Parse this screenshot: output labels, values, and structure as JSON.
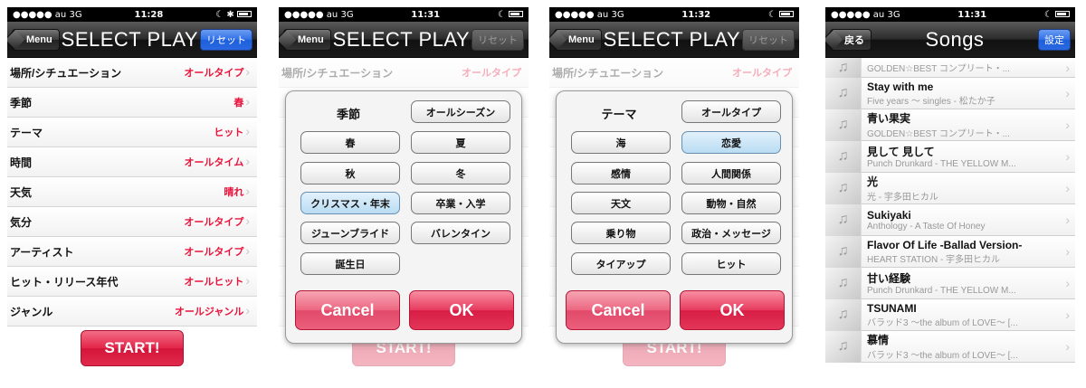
{
  "screens": [
    {
      "status": {
        "carrier": "●●●●● au  3G",
        "time": "11:28",
        "right": "☾ ✱"
      },
      "nav": {
        "back": "Menu",
        "title": "SELECT PLAY",
        "reset": "リセット"
      },
      "rows": [
        {
          "label": "場所/シチュエーション",
          "value": "オールタイプ"
        },
        {
          "label": "季節",
          "value": "春"
        },
        {
          "label": "テーマ",
          "value": "ヒット"
        },
        {
          "label": "時間",
          "value": "オールタイム"
        },
        {
          "label": "天気",
          "value": "晴れ"
        },
        {
          "label": "気分",
          "value": "オールタイプ"
        },
        {
          "label": "アーティスト",
          "value": "オールタイプ"
        },
        {
          "label": "ヒット・リリース年代",
          "value": "オールヒット"
        },
        {
          "label": "ジャンル",
          "value": "オールジャンル"
        }
      ],
      "start": "START!"
    },
    {
      "status": {
        "carrier": "●●●●● au  3G",
        "time": "11:31",
        "right": "☾"
      },
      "nav": {
        "back": "Menu",
        "title": "SELECT PLAY",
        "reset": "リセット"
      },
      "row_label": "場所/シチュエーション",
      "row_value": "オールタイプ",
      "dialog": {
        "heading": "季節",
        "options": [
          "オールシーズン",
          "春",
          "夏",
          "秋",
          "冬",
          "クリスマス・年末",
          "卒業・入学",
          "ジューンブライド",
          "バレンタイン",
          "誕生日"
        ],
        "selected": "クリスマス・年末",
        "cancel": "Cancel",
        "ok": "OK"
      },
      "start": "START!"
    },
    {
      "status": {
        "carrier": "●●●●● au  3G",
        "time": "11:32",
        "right": "☾"
      },
      "nav": {
        "back": "Menu",
        "title": "SELECT PLAY",
        "reset": "リセット"
      },
      "row_label": "場所/シチュエーション",
      "row_value": "オールタイプ",
      "dialog": {
        "heading": "テーマ",
        "options": [
          "オールタイプ",
          "海",
          "恋愛",
          "感情",
          "人間関係",
          "天文",
          "動物・自然",
          "乗り物",
          "政治・メッセージ",
          "タイアップ",
          "ヒット"
        ],
        "selected": "恋愛",
        "cancel": "Cancel",
        "ok": "OK"
      },
      "start": "START!"
    },
    {
      "status": {
        "carrier": "●●●●● au  3G",
        "time": "11:31",
        "right": "☾"
      },
      "nav": {
        "back": "戻る",
        "title": "Songs",
        "reset": "設定"
      },
      "partial_sub": "GOLDEN☆BEST コンプリート・...",
      "songs": [
        {
          "title": "Stay with me",
          "sub": "Five years 〜 singles - 松たか子"
        },
        {
          "title": "青い果実",
          "sub": "GOLDEN☆BEST コンプリート・..."
        },
        {
          "title": "見して 見して",
          "sub": "Punch Drunkard - THE YELLOW M..."
        },
        {
          "title": "光",
          "sub": "光 - 宇多田ヒカル"
        },
        {
          "title": "Sukiyaki",
          "sub": "Anthology - A Taste Of Honey"
        },
        {
          "title": "Flavor Of Life -Ballad Version-",
          "sub": "HEART STATION - 宇多田ヒカル"
        },
        {
          "title": "甘い経験",
          "sub": "Punch Drunkard - THE YELLOW M..."
        },
        {
          "title": "TSUNAMI",
          "sub": "バラッド3 〜the album of LOVE〜 [..."
        },
        {
          "title": "慕情",
          "sub": "バラッド3 〜the album of LOVE〜 [..."
        }
      ]
    }
  ],
  "colors": {
    "accent_red": "#e32548",
    "value_red": "#e8143b",
    "reset_blue": "#2f6fe7",
    "selected_blue": "#b9dcf3"
  },
  "icons": {
    "jacket": "music-note-icon",
    "chevron": "chevron-right-icon",
    "back": "back-arrow-button"
  }
}
